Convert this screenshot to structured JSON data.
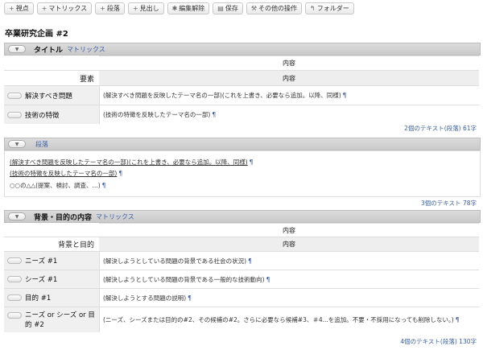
{
  "toolbar": [
    {
      "icon": "+",
      "name": "add-viewpoint-button",
      "label": "視点"
    },
    {
      "icon": "+",
      "name": "add-matrix-button",
      "label": "マトリックス"
    },
    {
      "icon": "+",
      "name": "add-paragraph-button",
      "label": "段落"
    },
    {
      "icon": "+",
      "name": "add-heading-button",
      "label": "見出し"
    },
    {
      "icon": "✱",
      "name": "cancel-edit-button",
      "label": "編集解除"
    },
    {
      "icon": "▤",
      "name": "save-button",
      "label": "保存"
    },
    {
      "icon": "⚒",
      "name": "other-ops-button",
      "label": "その他の操作"
    },
    {
      "icon": "↰",
      "name": "folder-button",
      "label": "フォルダー"
    }
  ],
  "page_title": "卒業研究企画 #2",
  "sec1": {
    "title": "タイトル",
    "type": "マトリックス",
    "header_content": "内容",
    "row_header_left": "要素",
    "row_header_right": "内容",
    "rows": [
      {
        "label": "解決すべき問題",
        "value": "(解決すべき問題を反映したテーマ名の一部)(これを上書き、必要なら追加。以降、同様)"
      },
      {
        "label": "技術の特徴",
        "value": "(技術の特徴を反映したテーマ名の一部)"
      }
    ],
    "count": "2個のテキスト(段落) 61字"
  },
  "sec2": {
    "type": "段落",
    "lines": [
      "(解決すべき問題を反映したテーマ名の一部)(これを上書き、必要なら追加。以降、同様)",
      "(技術の特徴を反映したテーマ名の一部)",
      "○○の△△(提案、検討、調査、...)"
    ],
    "count": "3個のテキスト 78字"
  },
  "sec3": {
    "title": "背景・目的の内容",
    "type": "マトリックス",
    "header_content": "内容",
    "row_header_left": "背景と目的",
    "row_header_right": "内容",
    "rows": [
      {
        "label": "ニーズ #1",
        "value": "(解決しようとしている問題の背景である社会の状況)"
      },
      {
        "label": "シーズ #1",
        "value": "(解決しようとしている問題の背景である一般的な技術動向)"
      },
      {
        "label": "目的 #1",
        "value": "(解決しようとする問題の説明)"
      },
      {
        "label": "ニーズ or シーズ or 目的 #2",
        "value": "(ニーズ、シーズまたは目的の#2、その候補の#2。さらに必要なら候補#3、＃4...を追加。不要・不採用になっても削除しない。)"
      }
    ],
    "count": "4個のテキスト(段落) 130字"
  },
  "pilcrow": "¶"
}
